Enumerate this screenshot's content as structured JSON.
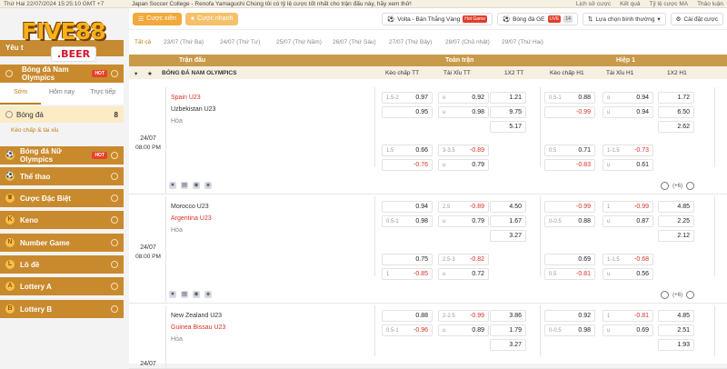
{
  "topbar": {
    "datetime": "Thứ Hai 22/07/2024 15:25:10 GMT +7",
    "ticker": "Japan Soccer College - Renofa Yamaguchi Chúng tôi có tỷ lệ cược tốt nhất cho trận đấu này, hãy xem thử!",
    "links": [
      "Lịch sử cược",
      "Kết quả",
      "Tỷ lệ cược MA",
      "Thảo luận"
    ]
  },
  "logo": {
    "main": "FIVE88",
    "sub": ".BEER"
  },
  "sidebar": {
    "yeu": "Yêu t",
    "head": "Bóng đá Nam Olympics",
    "hot": "HOT",
    "tabs": [
      "Sớm",
      "Hôm nay",
      "Trực tiếp"
    ],
    "sport": {
      "label": "Bóng đá",
      "count": "8"
    },
    "sub": "Kèo chấp & tài xỉu",
    "items": [
      {
        "label": "Bóng đá Nữ Olympics",
        "icon": "⚽",
        "hot": "HOT"
      },
      {
        "label": "Thể thao",
        "icon": "⚽"
      },
      {
        "label": "Cược Đặc Biệt",
        "icon": "♛"
      },
      {
        "label": "Keno",
        "icon": "K"
      },
      {
        "label": "Number Game",
        "icon": "N"
      },
      {
        "label": "Lô đề",
        "icon": "L"
      },
      {
        "label": "Lottery A",
        "icon": "A"
      },
      {
        "label": "Lottery B",
        "icon": "B"
      }
    ]
  },
  "nav": {
    "cuoc_xien": "Cược xiên",
    "cuoc_nhanh": "Cược nhanh",
    "volta": "Volta - Bàn Thắng Vàng",
    "volta_tag": "Hot Game",
    "live": "Bóng đá GE",
    "live_tag": "LIVE",
    "live_count": "14",
    "sort": "Lựa chọn bình thường",
    "settings": "Cài đặt cược"
  },
  "dates": [
    "Tất cả",
    "23/07 (Thứ Ba)",
    "24/07 (Thứ Tư)",
    "25/07 (Thứ Năm)",
    "26/07 (Thứ Sáu)",
    "27/07 (Thứ Bảy)",
    "28/07 (Chủ nhật)",
    "29/07 (Thứ Hai)"
  ],
  "headers": {
    "tran_dau": "Trận đấu",
    "toan_tran": "Toàn trận",
    "hiep1": "Hiệp 1",
    "league": "BÓNG ĐÁ NAM OLYMPICS",
    "cols": [
      "Kèo chấp TT",
      "Tài Xỉu TT",
      "1X2 TT",
      "Kèo chấp H1",
      "Tài Xỉu H1",
      "1X2 H1"
    ]
  },
  "matches": [
    {
      "date": "24/07",
      "time": "08:00 PM",
      "home": "Spain U23",
      "away": "Uzbekistan U23",
      "draw": "Hòa",
      "more": "(+6)",
      "rows": [
        [
          [
            "1.5-2",
            "0.97"
          ],
          [
            "o",
            "0.92"
          ],
          [
            "",
            "1.21"
          ],
          [
            "0.5-1",
            "0.88"
          ],
          [
            "o",
            "0.94"
          ],
          [
            "",
            "1.72"
          ]
        ],
        [
          [
            "",
            "0.95"
          ],
          [
            "u",
            "0.98"
          ],
          [
            "",
            "9.75"
          ],
          [
            "",
            "-0.99"
          ],
          [
            "u",
            "0.94"
          ],
          [
            "",
            "6.50"
          ]
        ],
        [
          null,
          null,
          [
            "",
            "5.17"
          ],
          null,
          null,
          [
            "",
            "2.62"
          ]
        ],
        [
          [
            "1.5",
            "0.66"
          ],
          [
            "3-3.5",
            "-0.89"
          ],
          null,
          [
            "0.5",
            "0.71"
          ],
          [
            "1-1.5",
            "-0.73"
          ],
          null
        ],
        [
          [
            "",
            "-0.76"
          ],
          [
            "u",
            "0.79"
          ],
          null,
          [
            "",
            "-0.83"
          ],
          [
            "u",
            "0.61"
          ],
          null
        ]
      ]
    },
    {
      "date": "24/07",
      "time": "08:00 PM",
      "home": "Morocco U23",
      "away": "Argentina U23",
      "draw": "Hòa",
      "more": "(+6)",
      "rows": [
        [
          [
            "",
            "0.94"
          ],
          [
            "2.5",
            "-0.89"
          ],
          [
            "",
            "4.50"
          ],
          [
            "",
            "-0.99"
          ],
          [
            "1",
            "-0.99"
          ],
          [
            "",
            "4.85"
          ]
        ],
        [
          [
            "0.5-1",
            "0.98"
          ],
          [
            "u",
            "0.79"
          ],
          [
            "",
            "1.67"
          ],
          [
            "0-0.5",
            "0.88"
          ],
          [
            "u",
            "0.87"
          ],
          [
            "",
            "2.25"
          ]
        ],
        [
          null,
          null,
          [
            "",
            "3.27"
          ],
          null,
          null,
          [
            "",
            "2.12"
          ]
        ],
        [
          [
            "",
            "0.75"
          ],
          [
            "2.5-3",
            "-0.82"
          ],
          null,
          [
            "",
            "0.69"
          ],
          [
            "1-1.5",
            "-0.68"
          ],
          null
        ],
        [
          [
            "1",
            "-0.85"
          ],
          [
            "u",
            "0.72"
          ],
          null,
          [
            "0.5",
            "-0.81"
          ],
          [
            "u",
            "0.56"
          ],
          null
        ]
      ]
    },
    {
      "date": "24/07",
      "time": "",
      "home": "New Zealand U23",
      "away": "Guinea Bissau U23",
      "draw": "Hòa",
      "more": "",
      "rows": [
        [
          [
            "",
            "0.88"
          ],
          [
            "2-2.5",
            "-0.99"
          ],
          [
            "",
            "3.86"
          ],
          [
            "",
            "0.92"
          ],
          [
            "1",
            "-0.81"
          ],
          [
            "",
            "4.85"
          ]
        ],
        [
          [
            "0.5-1",
            "-0.96"
          ],
          [
            "u",
            "0.89"
          ],
          [
            "",
            "1.79"
          ],
          [
            "0-0.5",
            "0.98"
          ],
          [
            "u",
            "0.69"
          ],
          [
            "",
            "2.51"
          ]
        ],
        [
          null,
          null,
          [
            "",
            "3.27"
          ],
          null,
          null,
          [
            "",
            "1.93"
          ]
        ]
      ]
    }
  ]
}
